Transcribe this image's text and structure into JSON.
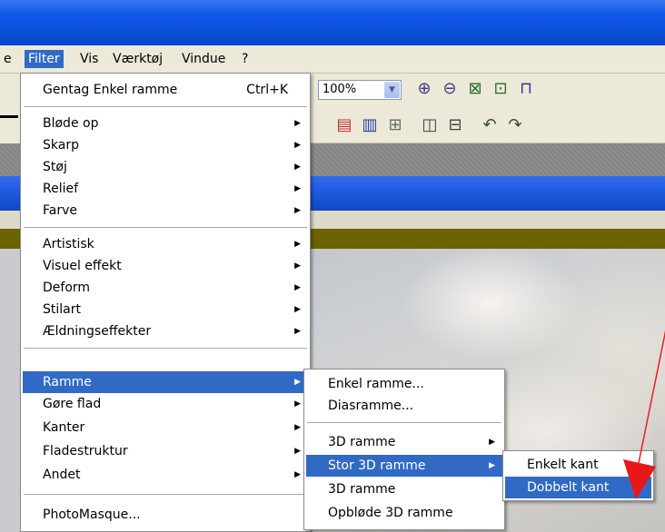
{
  "menubar": {
    "items": [
      "e",
      "Filter",
      "Vis",
      "Værktøj",
      "Vindue",
      "?"
    ]
  },
  "toolbar": {
    "zoom_value": "100%"
  },
  "filter_menu": {
    "items": [
      {
        "label": "Gentag Enkel ramme",
        "shortcut": "Ctrl+K"
      },
      {
        "label": "Bløde op"
      },
      {
        "label": "Skarp"
      },
      {
        "label": "Støj"
      },
      {
        "label": "Relief"
      },
      {
        "label": "Farve"
      },
      {
        "label": "Artistisk"
      },
      {
        "label": "Visuel effekt"
      },
      {
        "label": "Deform"
      },
      {
        "label": "Stilart"
      },
      {
        "label": "Ældningseffekter"
      },
      {
        "label": "Ramme"
      },
      {
        "label": "Gøre flad"
      },
      {
        "label": "Kanter"
      },
      {
        "label": "Fladestruktur"
      },
      {
        "label": "Andet"
      },
      {
        "label": "PhotoMasque..."
      }
    ]
  },
  "ramme_submenu": {
    "items": [
      {
        "label": "Enkel ramme..."
      },
      {
        "label": "Diasramme..."
      },
      {
        "label": "3D ramme"
      },
      {
        "label": "Stor 3D ramme"
      },
      {
        "label": "3D ramme"
      },
      {
        "label": "Opbløde 3D ramme"
      }
    ]
  },
  "stor3d_submenu": {
    "items": [
      {
        "label": "Enkelt kant"
      },
      {
        "label": "Dobbelt kant"
      }
    ]
  },
  "colors": {
    "highlight": "#316ac5",
    "annotation_arrow": "#e82020"
  }
}
